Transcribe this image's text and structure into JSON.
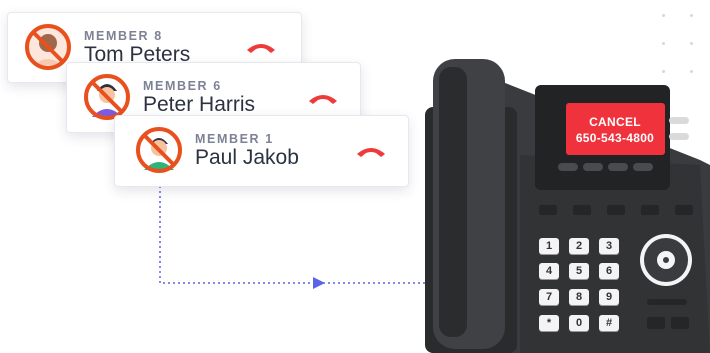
{
  "cards": [
    {
      "kicker": "MEMBER 8",
      "name": "Tom Peters",
      "accent": "#e8501e"
    },
    {
      "kicker": "MEMBER 6",
      "name": "Peter Harris",
      "accent": "#e8501e"
    },
    {
      "kicker": "MEMBER 1",
      "name": "Paul Jakob",
      "accent": "#e8501e"
    }
  ],
  "phone": {
    "screen_line1": "CANCEL",
    "screen_line2": "650-543-4800",
    "screen_color": "#f0323c",
    "keypad": [
      "1",
      "2",
      "3",
      "4",
      "5",
      "6",
      "7",
      "8",
      "9",
      "*",
      "0",
      "#"
    ]
  },
  "colors": {
    "connector": "#5b63e6",
    "hangup": "#ef3a3a",
    "phone_body": "#333436"
  }
}
